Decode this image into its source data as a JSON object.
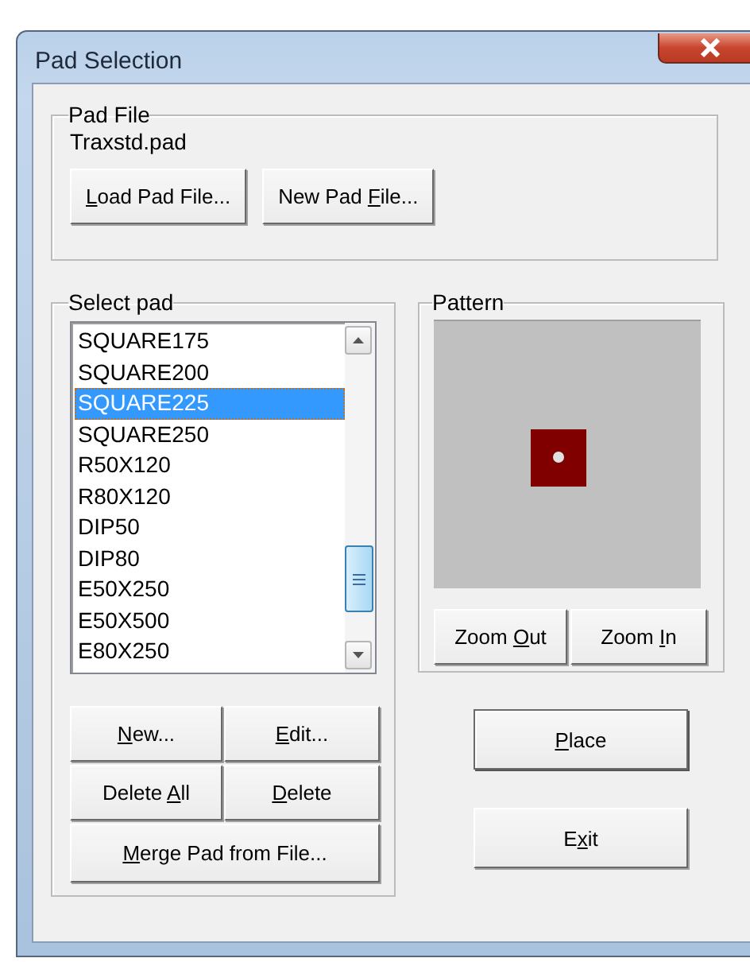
{
  "window": {
    "title": "Pad Selection"
  },
  "pad_file": {
    "title": "Pad File",
    "file_name": "Traxstd.pad",
    "buttons": [
      {
        "key": "L",
        "after": "oad Pad File..."
      },
      {
        "before": "New Pad ",
        "key": "F",
        "after": "ile..."
      }
    ]
  },
  "select_pad": {
    "title": "Select pad",
    "items": [
      {
        "label": "SQUARE175",
        "selected": false
      },
      {
        "label": "SQUARE200",
        "selected": false
      },
      {
        "label": "SQUARE225",
        "selected": true
      },
      {
        "label": "SQUARE250",
        "selected": false
      },
      {
        "label": "R50X120",
        "selected": false
      },
      {
        "label": "R80X120",
        "selected": false
      },
      {
        "label": "DIP50",
        "selected": false
      },
      {
        "label": "DIP80",
        "selected": false
      },
      {
        "label": "E50X250",
        "selected": false
      },
      {
        "label": "E50X500",
        "selected": false
      },
      {
        "label": "E80X250",
        "selected": false
      }
    ],
    "buttons": [
      {
        "key": "N",
        "after": "ew..."
      },
      {
        "key": "E",
        "after": "dit..."
      },
      {
        "before": "Delete ",
        "key": "A",
        "after": "ll"
      },
      {
        "key": "D",
        "after": "elete"
      },
      {
        "key": "M",
        "after": "erge Pad from File..."
      }
    ]
  },
  "pattern": {
    "title": "Pattern",
    "buttons": [
      {
        "before": "Zoom ",
        "key": "O",
        "after": "ut"
      },
      {
        "before": "Zoom ",
        "key": "I",
        "after": "n"
      }
    ]
  },
  "actions": [
    {
      "key": "P",
      "after": "lace"
    },
    {
      "before": "E",
      "key": "x",
      "after": "it"
    }
  ]
}
